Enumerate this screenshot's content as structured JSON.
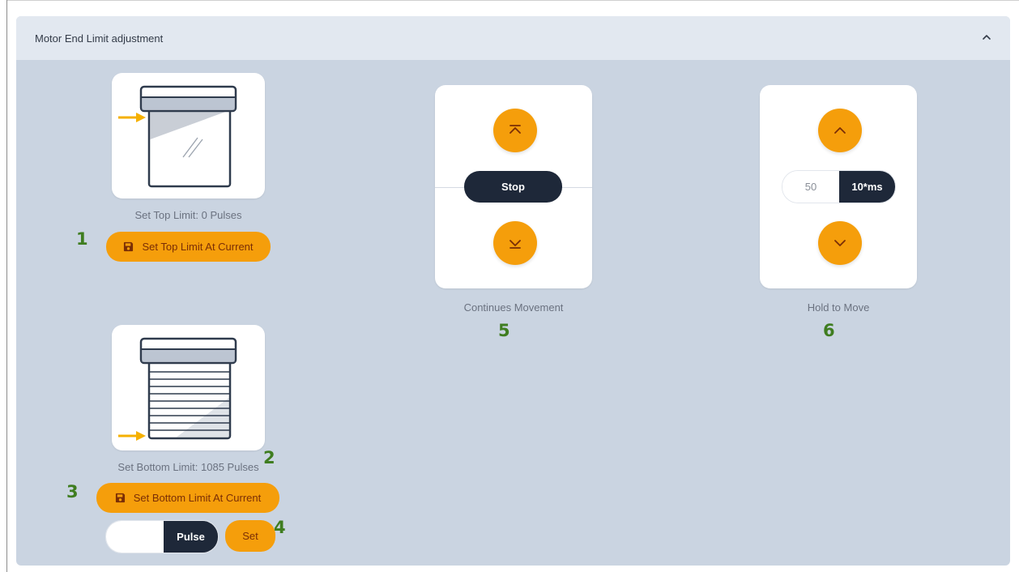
{
  "panel": {
    "title": "Motor End Limit adjustment"
  },
  "top_limit": {
    "caption": "Set Top Limit: 0 Pulses",
    "button_label": "Set Top Limit At Current"
  },
  "bottom_limit": {
    "caption": "Set Bottom Limit: 1085 Pulses",
    "button_label": "Set Bottom Limit At Current",
    "pulse_input_value": "",
    "pulse_unit": "Pulse",
    "set_label": "Set"
  },
  "continuous": {
    "stop_label": "Stop",
    "caption": "Continues Movement"
  },
  "hold": {
    "value": "50",
    "unit": "10*ms",
    "caption": "Hold to Move"
  },
  "annotations": {
    "n1": "1",
    "n2": "2",
    "n3": "3",
    "n4": "4",
    "n5": "5",
    "n6": "6"
  },
  "colors": {
    "accent": "#f59e0b",
    "dark": "#1e2839",
    "panel": "#cad4e1",
    "annotation": "#3f7d20"
  },
  "icons": {
    "collapse": "chevron-up-icon",
    "save": "floppy-disk-icon",
    "to_top": "double-chevron-up-icon",
    "to_bottom": "double-chevron-down-icon",
    "up": "chevron-up-icon",
    "down": "chevron-down-icon"
  }
}
